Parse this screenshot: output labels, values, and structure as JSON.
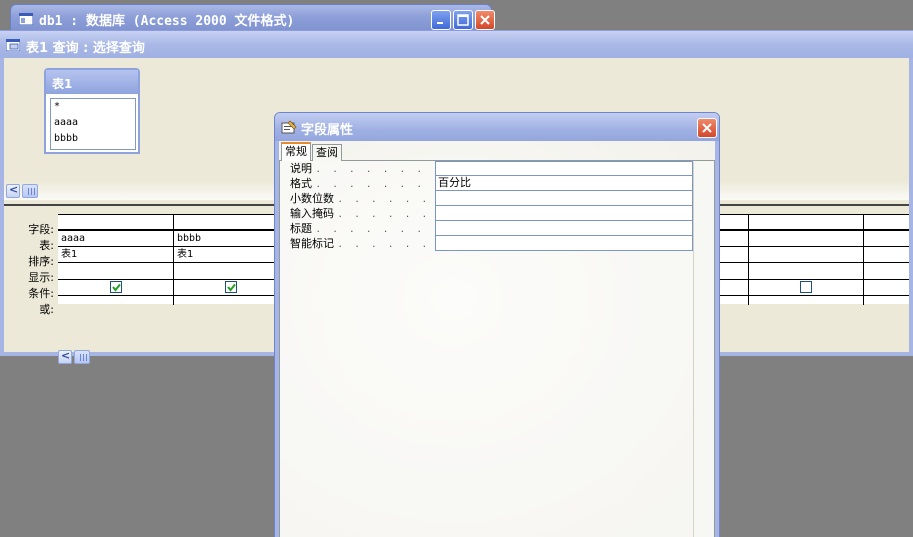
{
  "db_window": {
    "title": "db1 : 数据库 (Access 2000 文件格式)"
  },
  "query_window": {
    "title": "表1 查询 : 选择查询"
  },
  "table_box": {
    "title": "表1",
    "fields": [
      "*",
      "aaaa",
      "bbbb"
    ]
  },
  "grid": {
    "row_labels": [
      "字段:",
      "表:",
      "排序:",
      "显示:",
      "条件:",
      "或:"
    ],
    "columns": [
      {
        "field": "aaaa",
        "table": "表1",
        "show": true
      },
      {
        "field": "bbbb",
        "table": "表1",
        "show": true
      },
      {
        "field": "",
        "table": "",
        "show": false
      }
    ]
  },
  "field_properties": {
    "title": "字段属性",
    "tabs": [
      "常规",
      "查阅"
    ],
    "active_tab": "常规",
    "dots": ". . . . . . . . . .",
    "properties": [
      {
        "label": "说明",
        "value": ""
      },
      {
        "label": "格式",
        "value": "百分比"
      },
      {
        "label": "小数位数",
        "value": ""
      },
      {
        "label": "输入掩码",
        "value": ""
      },
      {
        "label": "标题",
        "value": ""
      },
      {
        "label": "智能标记",
        "value": ""
      }
    ]
  },
  "colors": {
    "title_blue": "#8d9fd8",
    "window_bg": "#ece9d8",
    "desktop": "#808080",
    "check_green": "#21a121"
  }
}
